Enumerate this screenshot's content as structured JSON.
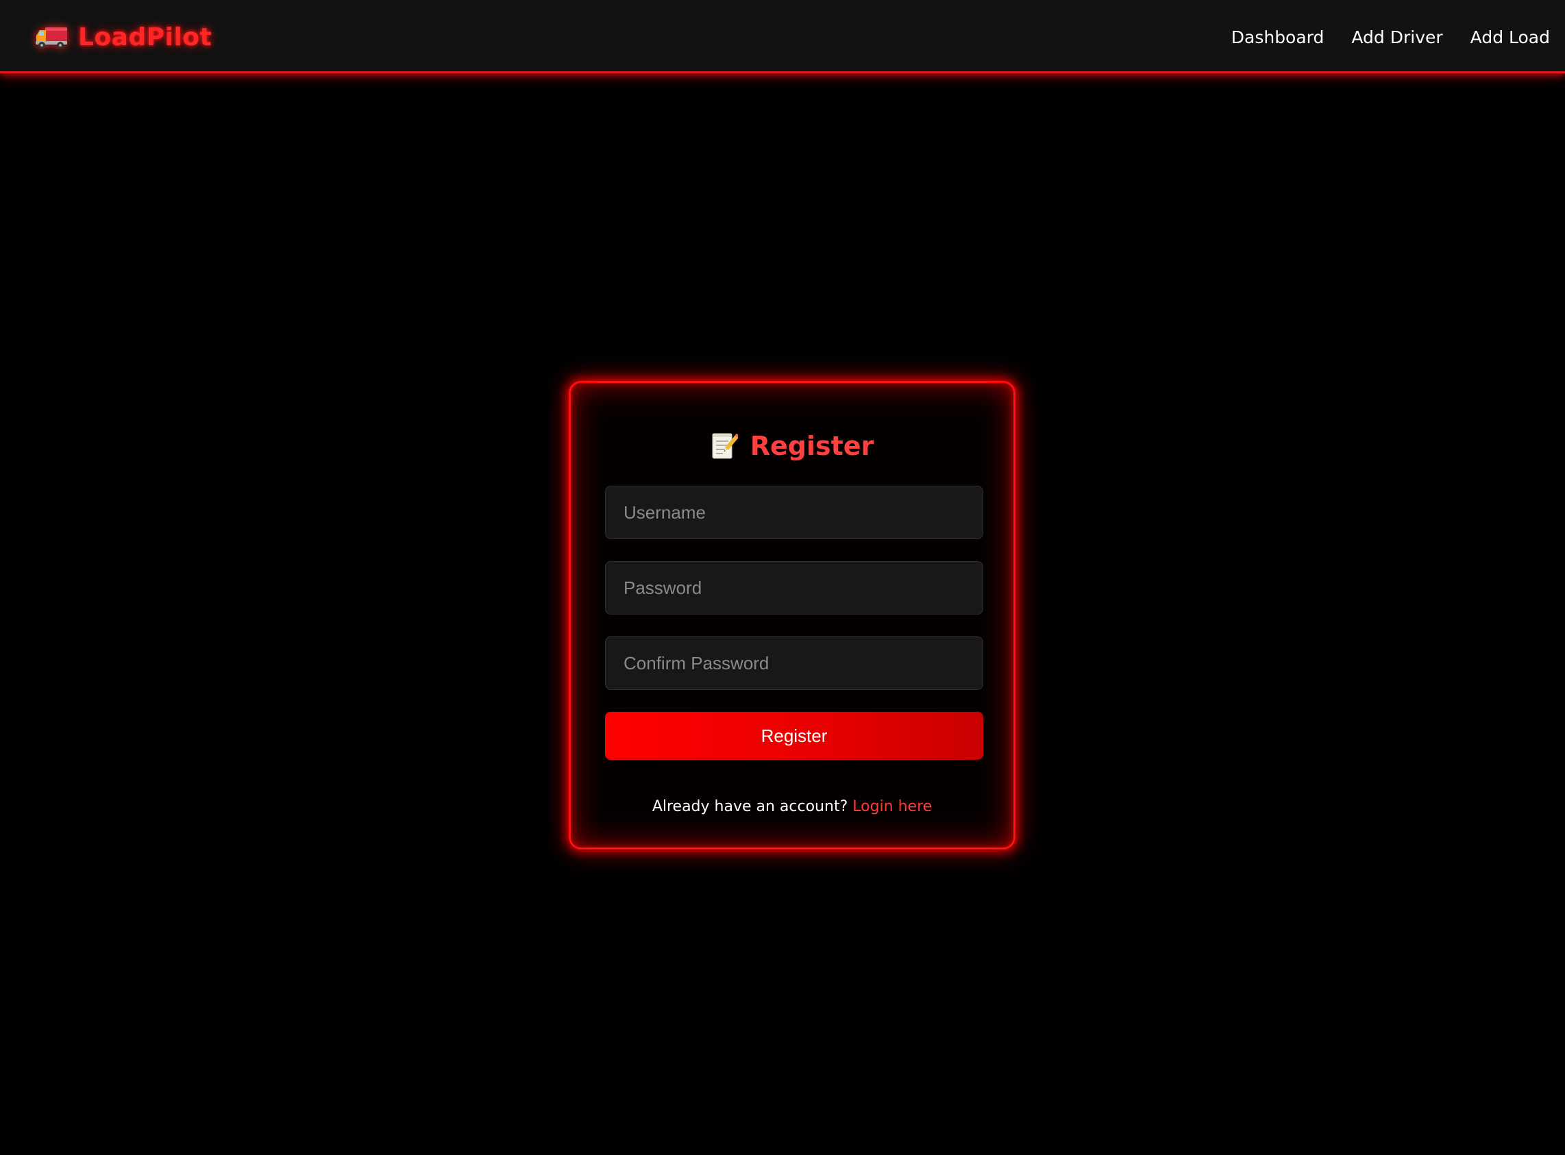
{
  "navbar": {
    "brand": "LoadPilot",
    "brand_icon": "delivery-truck-icon",
    "links": [
      {
        "label": "Dashboard"
      },
      {
        "label": "Add Driver"
      },
      {
        "label": "Add Load"
      }
    ]
  },
  "register_form": {
    "title": "Register",
    "title_icon": "memo-icon",
    "fields": {
      "username": {
        "placeholder": "Username",
        "value": ""
      },
      "password": {
        "placeholder": "Password",
        "value": ""
      },
      "confirm_password": {
        "placeholder": "Confirm Password",
        "value": ""
      }
    },
    "submit_label": "Register",
    "login_prompt": "Already have an account?",
    "login_link_label": "Login here"
  },
  "colors": {
    "accent": "#ff0000",
    "brand_text": "#ff2626",
    "title_text": "#ff4040",
    "link": "#ff3b3b",
    "navbar_bg": "#121212",
    "page_bg": "#000000",
    "input_bg": "#181818"
  }
}
